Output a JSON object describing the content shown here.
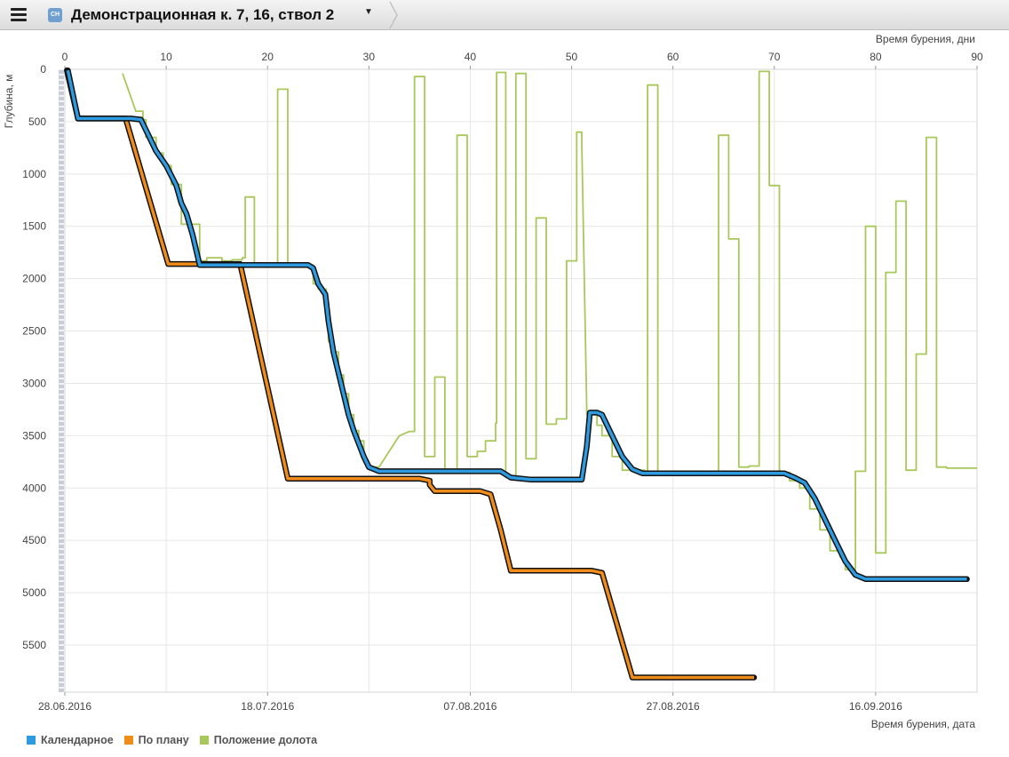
{
  "header": {
    "title": "Демонстрационная к. 7, 16, ствол 2",
    "badge": "СН"
  },
  "chart_data": {
    "type": "line",
    "ylabel": "Глубина, м",
    "xlabel_top": "Время бурения, дни",
    "xlabel_bottom": "Время бурения, дата",
    "xlim": [
      0,
      90
    ],
    "ylim": [
      5950,
      0
    ],
    "y_reversed": true,
    "grid": true,
    "legend_position": "bottom-left",
    "x_ticks": [
      0,
      10,
      20,
      30,
      40,
      50,
      60,
      70,
      80,
      90
    ],
    "y_ticks": [
      0,
      500,
      1000,
      1500,
      2000,
      2500,
      3000,
      3500,
      4000,
      4500,
      5000,
      5500
    ],
    "date_ticks": [
      {
        "x": 0,
        "label": "28.06.2016"
      },
      {
        "x": 20,
        "label": "18.07.2016"
      },
      {
        "x": 40,
        "label": "07.08.2016"
      },
      {
        "x": 60,
        "label": "27.08.2016"
      },
      {
        "x": 80,
        "label": "16.09.2016"
      }
    ],
    "series": [
      {
        "name": "Календарное",
        "color": "#2e9be0",
        "points": [
          [
            0.3,
            10
          ],
          [
            1.3,
            470
          ],
          [
            6.5,
            470
          ],
          [
            7.5,
            480
          ],
          [
            8,
            580
          ],
          [
            9,
            780
          ],
          [
            10,
            920
          ],
          [
            11,
            1110
          ],
          [
            11.5,
            1280
          ],
          [
            12,
            1380
          ],
          [
            12.6,
            1580
          ],
          [
            13.3,
            1870
          ],
          [
            17.5,
            1870
          ],
          [
            24,
            1870
          ],
          [
            24.5,
            1900
          ],
          [
            25,
            2050
          ],
          [
            25.7,
            2150
          ],
          [
            26,
            2400
          ],
          [
            26.5,
            2700
          ],
          [
            27,
            2900
          ],
          [
            27.5,
            3100
          ],
          [
            28,
            3300
          ],
          [
            28.5,
            3450
          ],
          [
            29.5,
            3700
          ],
          [
            30,
            3800
          ],
          [
            31,
            3840
          ],
          [
            36,
            3840
          ],
          [
            43,
            3840
          ],
          [
            44,
            3900
          ],
          [
            46,
            3920
          ],
          [
            51,
            3920
          ],
          [
            51.5,
            3600
          ],
          [
            51.8,
            3280
          ],
          [
            52.5,
            3280
          ],
          [
            53,
            3300
          ],
          [
            54,
            3500
          ],
          [
            55,
            3700
          ],
          [
            56,
            3820
          ],
          [
            57,
            3860
          ],
          [
            62,
            3860
          ],
          [
            71,
            3860
          ],
          [
            72,
            3900
          ],
          [
            73,
            3950
          ],
          [
            74,
            4100
          ],
          [
            75,
            4300
          ],
          [
            76,
            4500
          ],
          [
            77,
            4700
          ],
          [
            78,
            4830
          ],
          [
            79,
            4870
          ],
          [
            80,
            4870
          ],
          [
            89,
            4870
          ]
        ]
      },
      {
        "name": "По плану",
        "color": "#f08c1a",
        "points": [
          [
            0.2,
            10
          ],
          [
            1.3,
            470
          ],
          [
            6,
            470
          ],
          [
            10.2,
            1860
          ],
          [
            17,
            1860
          ],
          [
            17.3,
            1860
          ],
          [
            22,
            3910
          ],
          [
            33,
            3910
          ],
          [
            35,
            3910
          ],
          [
            36,
            3930
          ],
          [
            36,
            3970
          ],
          [
            36.5,
            4030
          ],
          [
            41,
            4030
          ],
          [
            42,
            4060
          ],
          [
            43,
            4400
          ],
          [
            44,
            4790
          ],
          [
            52,
            4790
          ],
          [
            53,
            4810
          ],
          [
            56,
            5810
          ],
          [
            68,
            5810
          ]
        ]
      },
      {
        "name": "Положение долота",
        "color": "#a8c85a",
        "points": [
          [
            5.7,
            40
          ],
          [
            7,
            400
          ],
          [
            7.7,
            400
          ],
          [
            7.7,
            480
          ],
          [
            8,
            480
          ],
          [
            8,
            650
          ],
          [
            9,
            650
          ],
          [
            9,
            800
          ],
          [
            9.7,
            800
          ],
          [
            9.7,
            920
          ],
          [
            10.5,
            920
          ],
          [
            10.5,
            1100
          ],
          [
            11.5,
            1100
          ],
          [
            11.5,
            1480
          ],
          [
            13.3,
            1480
          ],
          [
            13.3,
            1830
          ],
          [
            14,
            1830
          ],
          [
            14,
            1800
          ],
          [
            15.5,
            1800
          ],
          [
            15.5,
            1830
          ],
          [
            16.5,
            1830
          ],
          [
            16.5,
            1820
          ],
          [
            17.5,
            1820
          ],
          [
            17.5,
            1800
          ],
          [
            17.8,
            1800
          ],
          [
            17.8,
            1220
          ],
          [
            18.7,
            1220
          ],
          [
            18.7,
            1860
          ],
          [
            21,
            1860
          ],
          [
            21,
            190
          ],
          [
            22,
            190
          ],
          [
            22,
            1860
          ],
          [
            24,
            1860
          ],
          [
            24,
            1870
          ],
          [
            24.5,
            1870
          ],
          [
            24.5,
            2050
          ],
          [
            25,
            2050
          ],
          [
            25,
            2100
          ],
          [
            25.8,
            2100
          ],
          [
            25.8,
            2350
          ],
          [
            26,
            2350
          ],
          [
            26,
            2600
          ],
          [
            26.5,
            2600
          ],
          [
            26.5,
            2700
          ],
          [
            27,
            2700
          ],
          [
            27,
            2920
          ],
          [
            27.5,
            2920
          ],
          [
            27.5,
            3100
          ],
          [
            28,
            3100
          ],
          [
            28,
            3300
          ],
          [
            28.5,
            3300
          ],
          [
            28.5,
            3450
          ],
          [
            29,
            3450
          ],
          [
            29,
            3550
          ],
          [
            29.5,
            3550
          ],
          [
            29.5,
            3750
          ],
          [
            30,
            3750
          ],
          [
            30,
            3800
          ],
          [
            31,
            3800
          ],
          [
            33,
            3500
          ],
          [
            34,
            3460
          ],
          [
            34.5,
            3460
          ],
          [
            34.5,
            70
          ],
          [
            35.5,
            70
          ],
          [
            35.5,
            3700
          ],
          [
            36.5,
            3700
          ],
          [
            36.5,
            2940
          ],
          [
            37.5,
            2940
          ],
          [
            37.5,
            3840
          ],
          [
            38.7,
            3840
          ],
          [
            38.7,
            630
          ],
          [
            39.7,
            630
          ],
          [
            39.7,
            3700
          ],
          [
            40.7,
            3700
          ],
          [
            40.7,
            3650
          ],
          [
            41.5,
            3650
          ],
          [
            41.5,
            3550
          ],
          [
            42.5,
            3550
          ],
          [
            42.5,
            3380
          ],
          [
            42.6,
            3380
          ],
          [
            42.6,
            30
          ],
          [
            43.5,
            30
          ],
          [
            43.5,
            3900
          ],
          [
            44.5,
            3900
          ],
          [
            44.5,
            40
          ],
          [
            45.5,
            40
          ],
          [
            45.5,
            3720
          ],
          [
            46.5,
            3720
          ],
          [
            46.5,
            1420
          ],
          [
            47.5,
            1420
          ],
          [
            47.5,
            3390
          ],
          [
            48.5,
            3390
          ],
          [
            48.5,
            3340
          ],
          [
            49.5,
            3340
          ],
          [
            49.5,
            1830
          ],
          [
            50.5,
            1830
          ],
          [
            50.5,
            600
          ],
          [
            51,
            600
          ],
          [
            51,
            700
          ],
          [
            51.5,
            3300
          ],
          [
            52.5,
            3300
          ],
          [
            52.5,
            3400
          ],
          [
            53,
            3400
          ],
          [
            53,
            3500
          ],
          [
            54,
            3500
          ],
          [
            54,
            3700
          ],
          [
            55,
            3700
          ],
          [
            55,
            3830
          ],
          [
            57.2,
            3830
          ],
          [
            57.2,
            3860
          ],
          [
            57.5,
            3860
          ],
          [
            57.5,
            150
          ],
          [
            58.5,
            150
          ],
          [
            58.5,
            3860
          ],
          [
            64.5,
            3860
          ],
          [
            64.5,
            630
          ],
          [
            65.5,
            630
          ],
          [
            65.5,
            1620
          ],
          [
            66.5,
            1620
          ],
          [
            66.5,
            3800
          ],
          [
            67.5,
            3800
          ],
          [
            67.5,
            3790
          ],
          [
            68.5,
            3790
          ],
          [
            68.5,
            20
          ],
          [
            69.5,
            20
          ],
          [
            69.5,
            1110
          ],
          [
            70.5,
            1110
          ],
          [
            70.5,
            3850
          ],
          [
            71.5,
            3850
          ],
          [
            71.5,
            3930
          ],
          [
            72.5,
            3930
          ],
          [
            72.5,
            4000
          ],
          [
            73.5,
            4000
          ],
          [
            73.5,
            4200
          ],
          [
            74.5,
            4200
          ],
          [
            74.5,
            4400
          ],
          [
            75.5,
            4400
          ],
          [
            75.5,
            4600
          ],
          [
            76.5,
            4600
          ],
          [
            76.5,
            4660
          ],
          [
            77,
            4660
          ],
          [
            77,
            4780
          ],
          [
            78,
            4780
          ],
          [
            78,
            3840
          ],
          [
            79,
            3840
          ],
          [
            79,
            1500
          ],
          [
            80,
            1500
          ],
          [
            80,
            4620
          ],
          [
            81,
            4620
          ],
          [
            81,
            1940
          ],
          [
            82,
            1940
          ],
          [
            82,
            1260
          ],
          [
            83,
            1260
          ],
          [
            83,
            3830
          ],
          [
            84,
            3830
          ],
          [
            84,
            2720
          ],
          [
            85,
            2720
          ],
          [
            85,
            650
          ],
          [
            86,
            650
          ],
          [
            86,
            3800
          ],
          [
            87,
            3800
          ],
          [
            87,
            3810
          ],
          [
            90,
            3810
          ]
        ]
      }
    ]
  }
}
